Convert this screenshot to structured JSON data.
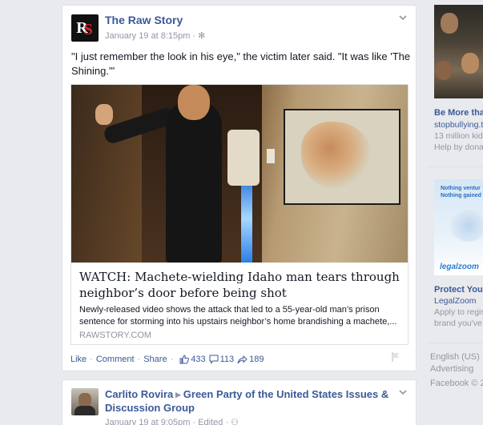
{
  "post1": {
    "page_name": "The Raw Story",
    "timestamp": "January 19 at 8:15pm",
    "status_text": "\"I just remember the look in his eye,\" the victim later said. \"It was like 'The Shining.'\"",
    "link": {
      "title": "WATCH: Machete-wielding Idaho man tears through neighbor’s door before being shot",
      "description": "Newly-released video shows the attack that led to a 55-year-old man’s prison sentence for storming into his upstairs neighbor’s home brandishing a machete,...",
      "source": "RAWSTORY.COM"
    },
    "actions": {
      "like": "Like",
      "comment": "Comment",
      "share": "Share",
      "likes_count": "433",
      "comments_count": "113",
      "shares_count": "189"
    }
  },
  "post2": {
    "author": "Carlito Rovira",
    "group": "Green Party of the United States Issues & Discussion Group",
    "timestamp": "January 19 at 9:05pm",
    "edited": "Edited"
  },
  "sidebar": {
    "ad1": {
      "title": "Be More tha",
      "url": "stopbullying.t",
      "line1": "13 million kid",
      "line2": "Help by dona"
    },
    "ad2": {
      "img_line1": "Nothing ventur",
      "img_line2": "Nothing gained",
      "img_brand": "legalzoom",
      "title": "Protect You",
      "url": "LegalZoom",
      "line1": "Apply to regis",
      "line2": "brand you've"
    },
    "footer": {
      "language": "English (US)",
      "advertising": "Advertising",
      "copyright": "Facebook © 2"
    }
  }
}
